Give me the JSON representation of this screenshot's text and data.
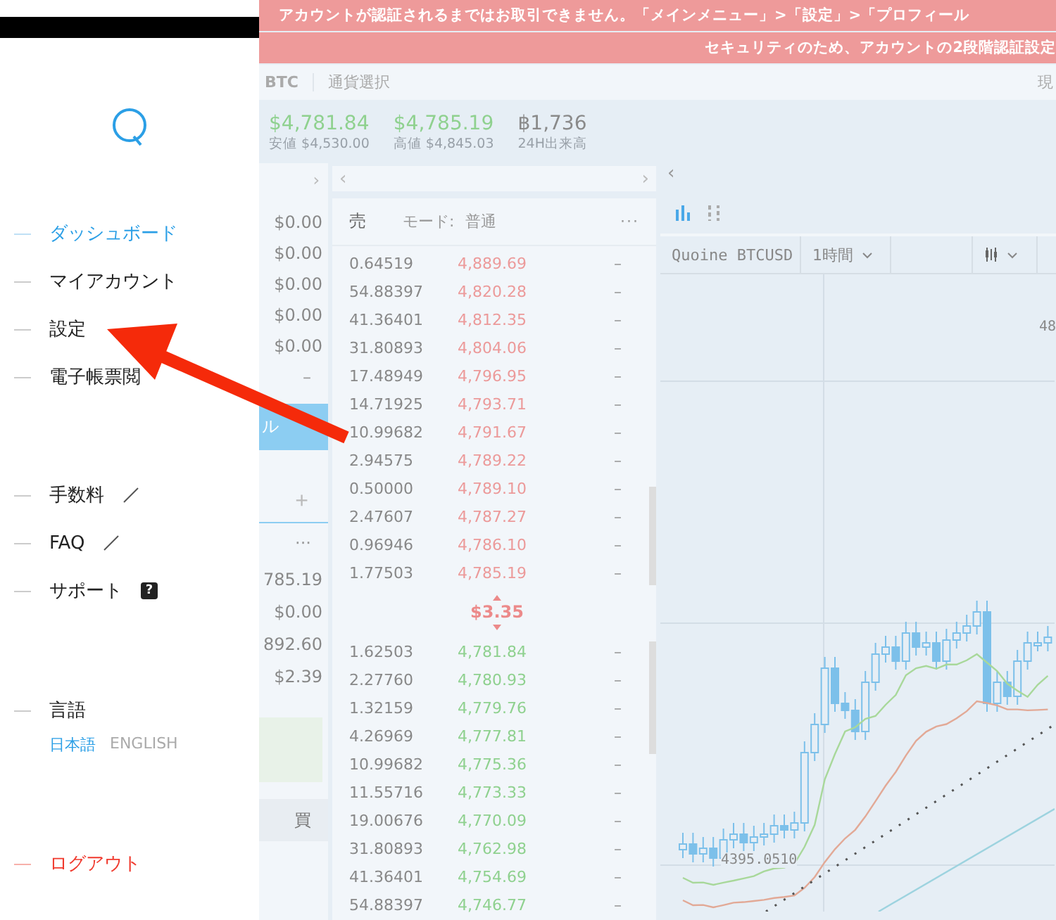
{
  "sidebar": {
    "menu": [
      {
        "label": "ダッシュボード",
        "selected": true
      },
      {
        "label": "マイアカウント",
        "selected": false
      },
      {
        "label": "設定",
        "selected": false
      },
      {
        "label": "電子帳票閲",
        "selected": false
      }
    ],
    "links": [
      {
        "label": "手数料",
        "kind": "external"
      },
      {
        "label": "FAQ",
        "kind": "external"
      },
      {
        "label": "サポート",
        "kind": "help",
        "badge": "?"
      }
    ],
    "language": {
      "label": "言語",
      "options": [
        {
          "label": "日本語",
          "selected": true
        },
        {
          "label": "ENGLISH",
          "selected": false
        }
      ]
    },
    "logout": "ログアウト"
  },
  "banners": [
    "アカウントが認証されるまではお取引できません。「メインメニュー」>「設定」>「プロフィール",
    "セキュリティのため、アカウントの2段階認証設定"
  ],
  "header": {
    "pair": "BTC",
    "currency_select": "通貨選択",
    "column_3": "現"
  },
  "ticker": [
    {
      "value": "$4,781.84",
      "caption": "安値 $4,530.00",
      "color": "#8fd18f"
    },
    {
      "value": "$4,785.19",
      "caption": "高値 $4,845.03",
      "color": "#8fd18f"
    },
    {
      "value": "฿1,736",
      "caption": "24H出来高",
      "color": "#8a8a8a"
    }
  ],
  "left_panel": {
    "nav": "›",
    "balances": [
      "$0.00",
      "$0.00",
      "$0.00",
      "$0.00",
      "$0.00"
    ],
    "dash": "–",
    "button": "ル",
    "add": "+",
    "more": "···",
    "totals": [
      "785.19",
      "$0.00",
      "892.60",
      "$2.39"
    ],
    "buy": "買"
  },
  "order_book": {
    "nav_prev": "‹",
    "nav_next": "›",
    "side": "売",
    "mode_label": "モード:",
    "mode": "普通",
    "more": "···",
    "asks": [
      {
        "amount": "0.64519",
        "price": "4,889.69",
        "column_3": "–"
      },
      {
        "amount": "54.88397",
        "price": "4,820.28",
        "column_3": "–"
      },
      {
        "amount": "41.36401",
        "price": "4,812.35",
        "column_3": "–"
      },
      {
        "amount": "31.80893",
        "price": "4,804.06",
        "column_3": "–"
      },
      {
        "amount": "17.48949",
        "price": "4,796.95",
        "column_3": "–"
      },
      {
        "amount": "14.71925",
        "price": "4,793.71",
        "column_3": "–"
      },
      {
        "amount": "10.99682",
        "price": "4,791.67",
        "column_3": "–"
      },
      {
        "amount": "2.94575",
        "price": "4,789.22",
        "column_3": "–"
      },
      {
        "amount": "0.50000",
        "price": "4,789.10",
        "column_3": "–"
      },
      {
        "amount": "2.47607",
        "price": "4,787.27",
        "column_3": "–"
      },
      {
        "amount": "0.96946",
        "price": "4,786.10",
        "column_3": "–"
      },
      {
        "amount": "1.77503",
        "price": "4,785.19",
        "column_3": "–"
      }
    ],
    "spread": "$3.35",
    "bids": [
      {
        "amount": "1.62503",
        "price": "4,781.84",
        "column_3": "–"
      },
      {
        "amount": "2.27760",
        "price": "4,780.93",
        "column_3": "–"
      },
      {
        "amount": "1.32159",
        "price": "4,779.76",
        "column_3": "–"
      },
      {
        "amount": "4.26969",
        "price": "4,777.81",
        "column_3": "–"
      },
      {
        "amount": "10.99682",
        "price": "4,775.36",
        "column_3": "–"
      },
      {
        "amount": "11.55716",
        "price": "4,773.33",
        "column_3": "–"
      },
      {
        "amount": "19.00676",
        "price": "4,770.09",
        "column_3": "–"
      },
      {
        "amount": "31.80893",
        "price": "4,762.98",
        "column_3": "–"
      },
      {
        "amount": "41.36401",
        "price": "4,754.69",
        "column_3": "–"
      },
      {
        "amount": "54.88397",
        "price": "4,746.77",
        "column_3": "–"
      }
    ]
  },
  "chart": {
    "nav_prev": "‹",
    "symbol": "Quoine BTCUSD",
    "interval": "1時間",
    "price_labels": [
      "48",
      "4395.0510"
    ]
  }
}
